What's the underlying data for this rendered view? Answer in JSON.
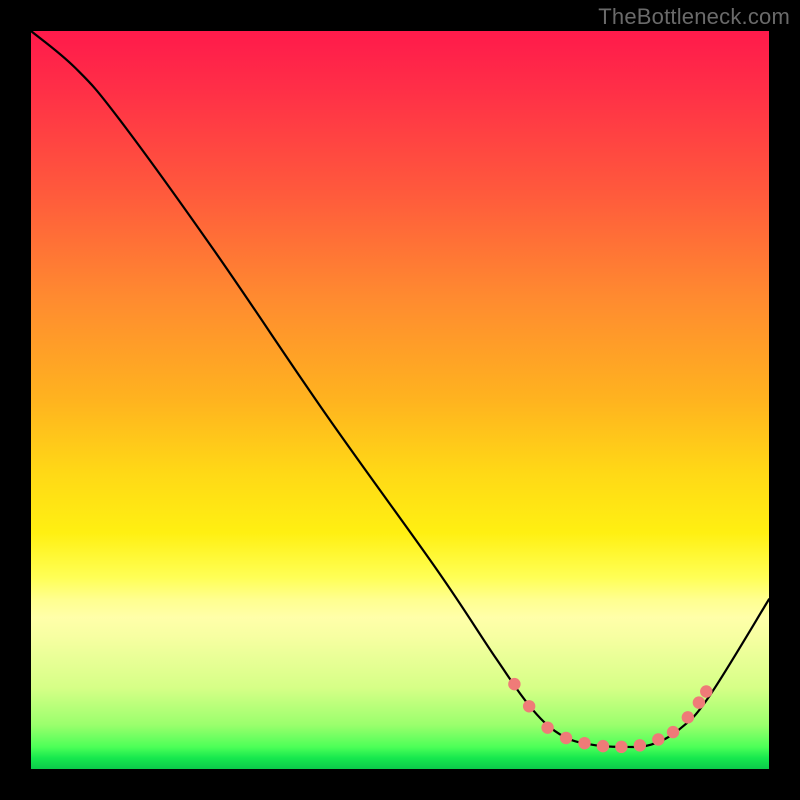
{
  "attribution": "TheBottleneck.com",
  "chart_data": {
    "type": "line",
    "title": "",
    "xlabel": "",
    "ylabel": "",
    "xlim": [
      0,
      100
    ],
    "ylim": [
      0,
      100
    ],
    "grid": false,
    "legend": false,
    "curve": [
      {
        "x": 0,
        "y": 100
      },
      {
        "x": 6,
        "y": 95
      },
      {
        "x": 12,
        "y": 88
      },
      {
        "x": 25,
        "y": 70
      },
      {
        "x": 40,
        "y": 48
      },
      {
        "x": 55,
        "y": 27
      },
      {
        "x": 63,
        "y": 15
      },
      {
        "x": 68,
        "y": 8
      },
      {
        "x": 72,
        "y": 4.5
      },
      {
        "x": 76,
        "y": 3.3
      },
      {
        "x": 80,
        "y": 3.0
      },
      {
        "x": 84,
        "y": 3.3
      },
      {
        "x": 88,
        "y": 5.5
      },
      {
        "x": 92,
        "y": 10
      },
      {
        "x": 100,
        "y": 23
      }
    ],
    "markers": [
      {
        "x": 65.5,
        "y": 11.5
      },
      {
        "x": 67.5,
        "y": 8.5
      },
      {
        "x": 70.0,
        "y": 5.6
      },
      {
        "x": 72.5,
        "y": 4.2
      },
      {
        "x": 75.0,
        "y": 3.5
      },
      {
        "x": 77.5,
        "y": 3.1
      },
      {
        "x": 80.0,
        "y": 3.0
      },
      {
        "x": 82.5,
        "y": 3.2
      },
      {
        "x": 85.0,
        "y": 4.0
      },
      {
        "x": 87.0,
        "y": 5.0
      },
      {
        "x": 89.0,
        "y": 7.0
      },
      {
        "x": 90.5,
        "y": 9.0
      },
      {
        "x": 91.5,
        "y": 10.5
      }
    ],
    "marker_radius": 6.2,
    "background_gradient_stops": [
      {
        "pos": 0,
        "color": "#ff1a4b"
      },
      {
        "pos": 0.36,
        "color": "#ff8a30"
      },
      {
        "pos": 0.68,
        "color": "#fff012"
      },
      {
        "pos": 0.82,
        "color": "#f7ffa2"
      },
      {
        "pos": 1.0,
        "color": "#0cc94a"
      }
    ]
  }
}
